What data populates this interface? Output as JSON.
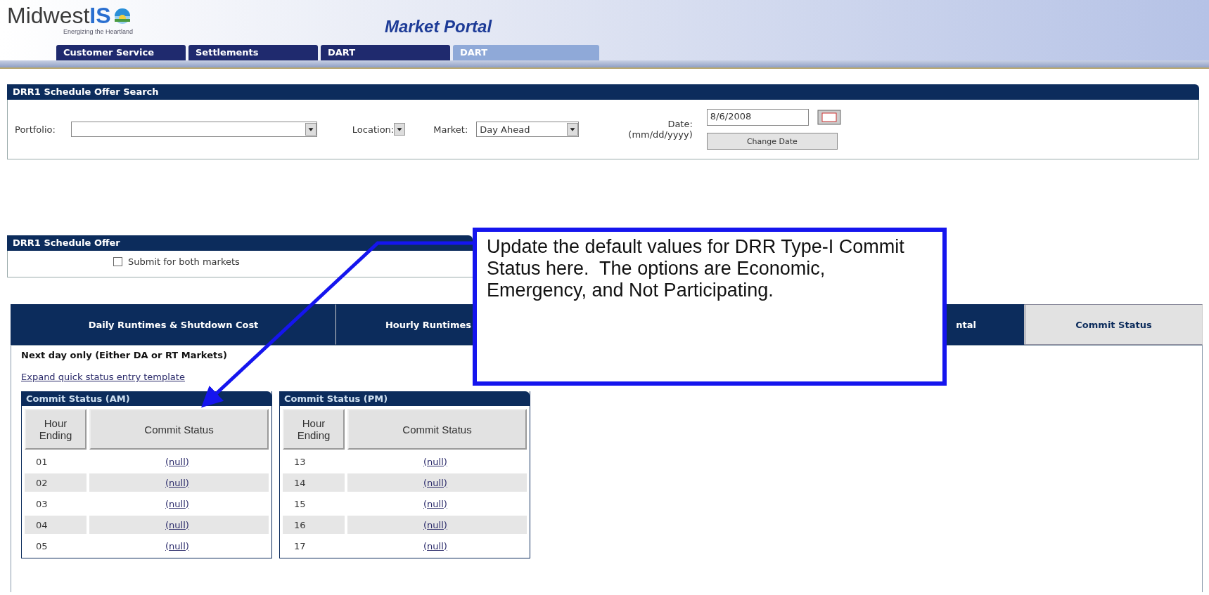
{
  "header": {
    "logo": {
      "name": "Midwest",
      "accent": "IS",
      "tagline": "Energizing the Heartland"
    },
    "title": "Market Portal",
    "nav_tabs": [
      {
        "label": "Customer Service",
        "selected": false
      },
      {
        "label": "Settlements",
        "selected": false
      },
      {
        "label": "DART",
        "selected": false
      },
      {
        "label": "DART",
        "selected": true
      }
    ]
  },
  "search": {
    "title": "DRR1 Schedule Offer Search",
    "portfolio_label": "Portfolio:",
    "location_label": "Location:",
    "market_label": "Market:",
    "market_value": "Day Ahead",
    "date_label": "Date:",
    "date_format": "(mm/dd/yyyy)",
    "date_value": "8/6/2008",
    "button": "Change Date"
  },
  "schedule_offer": {
    "title": "DRR1 Schedule Offer",
    "checkbox": {
      "label": "Submit for both markets",
      "checked": false
    }
  },
  "tabs": [
    {
      "label": "Daily Runtimes & Shutdown Cost",
      "selected": false
    },
    {
      "label": "Hourly Runtimes",
      "selected": false
    },
    {
      "label": "ntal",
      "selected": false
    },
    {
      "label": "Commit Status",
      "selected": true
    }
  ],
  "content": {
    "note": "Next day only (Either DA or RT Markets)",
    "link": "Expand quick status entry template",
    "tables": [
      {
        "title": "Commit Status (AM)",
        "columns": [
          "Hour Ending",
          "Commit Status"
        ],
        "rows": [
          [
            "01",
            "(null)"
          ],
          [
            "02",
            "(null)"
          ],
          [
            "03",
            "(null)"
          ],
          [
            "04",
            "(null)"
          ],
          [
            "05",
            "(null)"
          ]
        ]
      },
      {
        "title": "Commit Status (PM)",
        "columns": [
          "Hour Ending",
          "Commit Status"
        ],
        "rows": [
          [
            "13",
            "(null)"
          ],
          [
            "14",
            "(null)"
          ],
          [
            "15",
            "(null)"
          ],
          [
            "16",
            "(null)"
          ],
          [
            "17",
            "(null)"
          ]
        ]
      }
    ]
  },
  "callout": {
    "text": "Update the default values for DRR Type-I Commit Status here.  The options are Economic, Emergency, and Not Participating."
  }
}
